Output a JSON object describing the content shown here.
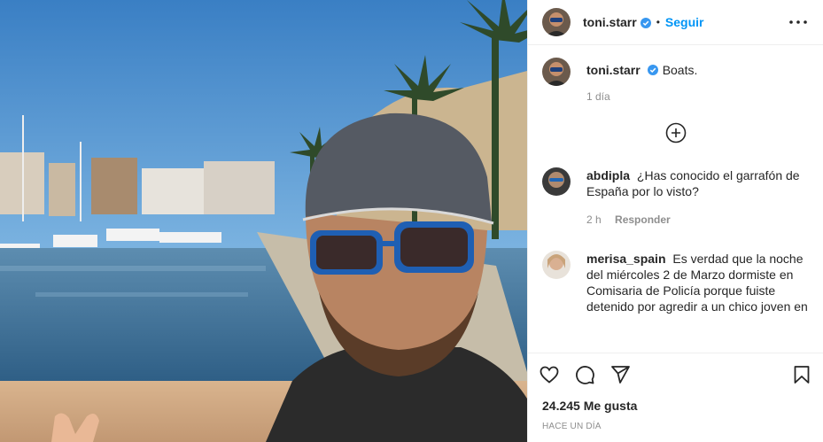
{
  "post": {
    "author": "toni.starr",
    "follow_label": "Seguir",
    "dot": "•",
    "caption": {
      "username": "toni.starr",
      "text": "Boats.",
      "time": "1 día"
    },
    "comments": [
      {
        "username": "abdipla",
        "text": "¿Has conocido el garrafón de España por lo visto?",
        "time": "2 h",
        "reply_label": "Responder"
      },
      {
        "username": "merisa_spain",
        "text": "Es verdad que la noche del miércoles 2 de Marzo dormiste en Comisaria de Policía porque fuiste detenido por agredir a un chico joven en"
      }
    ],
    "likes": "24.245 Me gusta",
    "timestamp": "HACE UN DÍA"
  },
  "icons": {
    "verified": "verified-badge-icon",
    "more": "more-options-icon",
    "load_more": "plus-circle-icon",
    "like": "heart-icon",
    "comment": "comment-icon",
    "share": "share-icon",
    "save": "bookmark-icon"
  },
  "colors": {
    "accent": "#0095f6",
    "verified": "#3897f0",
    "muted": "#8e8e8e",
    "text": "#262626"
  }
}
